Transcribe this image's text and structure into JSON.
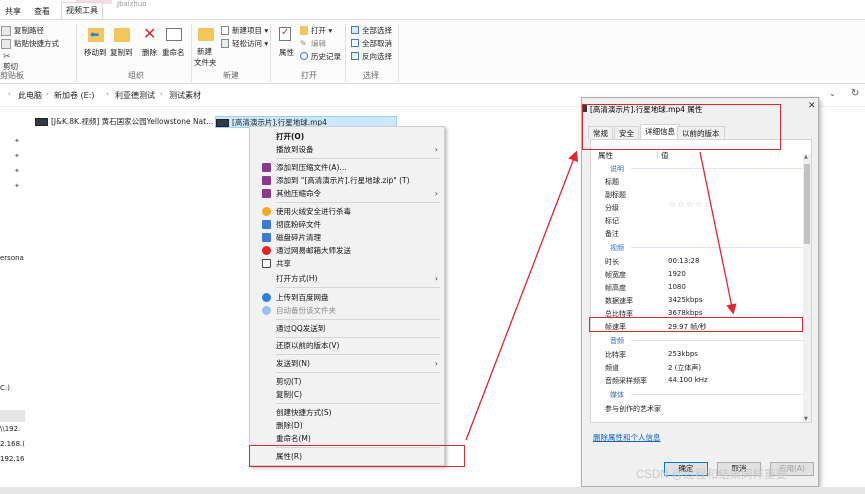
{
  "ribbon": {
    "tabs": [
      "共享",
      "查看",
      "视频工具"
    ],
    "active_tab_index": 2,
    "context_hint": "Jbaizhuo",
    "clipboard": {
      "copy_path": "复制路径",
      "paste_shortcut": "粘贴快捷方式",
      "cut": "剪切",
      "label": "剪贴板"
    },
    "organize": {
      "move_to": "移动到",
      "copy_to": "复制到",
      "delete": "删除",
      "rename": "重命名",
      "label": "组织"
    },
    "new": {
      "new_folder_line1": "新建",
      "new_folder_line2": "文件夹",
      "new_item": "新建项目 ▾",
      "easy_access": "轻松访问 ▾",
      "label": "新建"
    },
    "open": {
      "properties": "属性",
      "open": "打开 ▾",
      "edit": "编辑",
      "history": "历史记录",
      "label": "打开"
    },
    "select": {
      "select_all": "全部选择",
      "select_none": "全部取消",
      "invert": "反向选择",
      "label": "选择"
    }
  },
  "address": {
    "crumbs": [
      "此电脑",
      "新加卷 (E:)",
      "利亚德测试",
      "测试素材"
    ]
  },
  "nav": {
    "partial_items": [
      "ersona",
      "C:)",
      "\\\\192.",
      "2.168.(",
      "192.16"
    ]
  },
  "files": [
    {
      "name": "[J&K.8K.视频] 黄石国家公园Yellowstone Nat...",
      "selected": false
    },
    {
      "name": "[高清演示片].行星地球.mp4",
      "selected": true
    }
  ],
  "context_menu": {
    "items": [
      {
        "label": "打开(O)",
        "bold": true
      },
      {
        "label": "播放到设备",
        "submenu": true
      },
      {
        "label": "添加到压缩文件(A)...",
        "icon_color": "#8b3a8b"
      },
      {
        "label": "添加到 \"[高清演示片].行星地球.zip\" (T)",
        "icon_color": "#8b3a8b"
      },
      {
        "label": "其他压缩命令",
        "icon_color": "#8b3a8b",
        "submenu": true
      },
      {
        "label": "使用火绒安全进行杀毒",
        "icon_color": "#f5a623"
      },
      {
        "label": "彻底粉碎文件",
        "icon_color": "#3b7bd8"
      },
      {
        "label": "磁盘碎片清理",
        "icon_color": "#3b7bd8"
      },
      {
        "label": "通过网易邮箱大师发送",
        "icon_color": "#e02424"
      },
      {
        "label": "共享",
        "icon_color": "#444444"
      },
      {
        "label": "打开方式(H)",
        "submenu": true
      },
      {
        "label": "上传到百度网盘",
        "icon_color": "#2f7fe0"
      },
      {
        "label": "自动备份该文件夹",
        "icon_color": "#2f7fe0",
        "dim": true
      },
      {
        "label": "通过QQ发送到"
      },
      {
        "label": "还原以前的版本(V)"
      },
      {
        "label": "发送到(N)",
        "submenu": true
      },
      {
        "label": "剪切(T)"
      },
      {
        "label": "复制(C)"
      },
      {
        "label": "创建快捷方式(S)"
      },
      {
        "label": "删除(D)"
      },
      {
        "label": "重命名(M)"
      },
      {
        "label": "属性(R)"
      }
    ]
  },
  "dialog": {
    "title": "[高清演示片].行星地球.mp4 属性",
    "close": "✕",
    "tabs": [
      "常规",
      "安全",
      "详细信息",
      "以前的版本"
    ],
    "active_tab_index": 2,
    "headers": {
      "property": "属性",
      "value": "值"
    },
    "sections": {
      "description": "说明",
      "video": "视频",
      "audio": "音频",
      "media": "媒体"
    },
    "description_props": [
      "标题",
      "副标题",
      "分级",
      "标记",
      "备注"
    ],
    "rating_stars": "☆☆☆☆☆",
    "video_props": [
      {
        "name": "时长",
        "value": "00:13:28"
      },
      {
        "name": "帧宽度",
        "value": "1920"
      },
      {
        "name": "帧高度",
        "value": "1080"
      },
      {
        "name": "数据速率",
        "value": "3425kbps"
      },
      {
        "name": "总比特率",
        "value": "3678kbps"
      },
      {
        "name": "帧速率",
        "value": "29.97 帧/秒"
      }
    ],
    "audio_props": [
      {
        "name": "比特率",
        "value": "253kbps"
      },
      {
        "name": "频道",
        "value": "2 (立体声)"
      },
      {
        "name": "音频采样频率",
        "value": "44.100 kHz"
      }
    ],
    "media_props": [
      "参与创作的艺术家"
    ],
    "remove_link": "删除属性和个人信息",
    "buttons": {
      "ok": "确定",
      "cancel": "取消",
      "apply": "应用(A)"
    }
  },
  "watermark": "CSDN @过程和结果同样重要",
  "colors": {
    "annotation_red": "#e8242d",
    "selection_blue": "#cce8ff",
    "link_blue": "#0a62c4"
  }
}
